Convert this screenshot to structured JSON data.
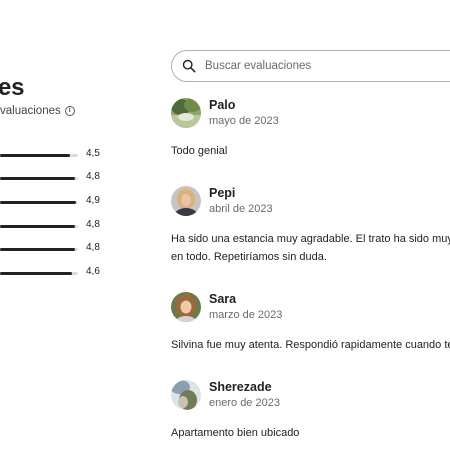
{
  "header": {
    "title": "es",
    "subtitle": "valuaciones",
    "info_icon": "info-icon"
  },
  "ratings": [
    {
      "value": "4,5",
      "fraction": 0.9
    },
    {
      "value": "4,8",
      "fraction": 0.96
    },
    {
      "value": "4,9",
      "fraction": 0.98
    },
    {
      "value": "4,8",
      "fraction": 0.96
    },
    {
      "value": "4,8",
      "fraction": 0.96
    },
    {
      "value": "4,6",
      "fraction": 0.92
    }
  ],
  "search": {
    "placeholder": "Buscar evaluaciones",
    "icon": "search-icon"
  },
  "reviews": [
    {
      "name": "Palo",
      "date": "mayo de 2023",
      "lines": [
        "Todo genial"
      ]
    },
    {
      "name": "Pepi",
      "date": "abril de 2023",
      "lines": [
        "Ha sido una estancia muy agradable. El trato ha sido muy am",
        "en todo. Repetiríamos sin duda."
      ]
    },
    {
      "name": "Sara",
      "date": "marzo de 2023",
      "lines": [
        "Silvina fue muy atenta. Respondió rapidamente cuando tenia"
      ]
    },
    {
      "name": "Sherezade",
      "date": "enero de 2023",
      "lines": [
        "Apartamento bien ubicado"
      ]
    }
  ],
  "colors": {
    "text": "#222222",
    "muted": "#6a6a6a",
    "bar": "#222222",
    "border": "#b0b0b0"
  }
}
